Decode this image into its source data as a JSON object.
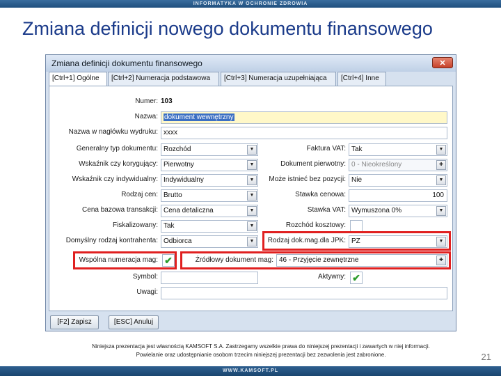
{
  "slide": {
    "header_text": "INFORMATYKA W OCHRONIE ZDROWIA",
    "title": "Zmiana definicji nowego dokumentu finansowego",
    "footer_line1": "Niniejsza prezentacja jest własnością KAMSOFT S.A. Zastrzegamy wszelkie prawa do niniejszej prezentacji i zawartych w niej informacji.",
    "footer_line2": "Powielanie oraz udostępnianie osobom trzecim niniejszej prezentacji bez zezwolenia jest zabronione.",
    "bottom_text": "WWW.KAMSOFT.PL",
    "page_number": "21"
  },
  "window": {
    "title": "Zmiana definicji dokumentu finansowego",
    "close_symbol": "✕",
    "tabs": [
      {
        "label": "[Ctrl+1] Ogólne",
        "active": true
      },
      {
        "label": "[Ctrl+2] Numeracja podstawowa",
        "active": false
      },
      {
        "label": "[Ctrl+3] Numeracja uzupełniająca",
        "active": false
      },
      {
        "label": "[Ctrl+4] Inne",
        "active": false
      }
    ]
  },
  "form": {
    "numer_label": "Numer:",
    "numer_value": "103",
    "nazwa_label": "Nazwa:",
    "nazwa_value": "dokument wewnętrzny",
    "naglowek_label": "Nazwa w nagłówku wydruku:",
    "naglowek_value": "xxxx",
    "generalny_label": "Generalny typ dokumentu:",
    "generalny_value": "Rozchód",
    "korygujacy_label": "Wskaźnik czy korygujący:",
    "korygujacy_value": "Pierwotny",
    "indywidualny_label": "Wskaźnik czy indywidualny:",
    "indywidualny_value": "Indywidualny",
    "rodzaj_cen_label": "Rodzaj cen:",
    "rodzaj_cen_value": "Brutto",
    "cena_bazowa_label": "Cena bazowa transakcji:",
    "cena_bazowa_value": "Cena detaliczna",
    "fiskalizowany_label": "Fiskalizowany:",
    "fiskalizowany_value": "Tak",
    "domyslny_label": "Domyślny rodzaj kontrahenta:",
    "domyslny_value": "Odbiorca",
    "wspolna_label": "Wspólna numeracja mag:",
    "wspolna_checked": "✔",
    "symbol_label": "Symbol:",
    "symbol_value": "",
    "uwagi_label": "Uwagi:",
    "uwagi_value": "",
    "faktura_vat_label": "Faktura VAT:",
    "faktura_vat_value": "Tak",
    "dok_pierwotny_label": "Dokument pierwotny:",
    "dok_pierwotny_value": "0 - Nieokreślony",
    "moze_istniec_label": "Może istnieć bez pozycji:",
    "moze_istniec_value": "Nie",
    "stawka_cenowa_label": "Stawka cenowa:",
    "stawka_cenowa_value": "100",
    "stawka_vat_label": "Stawka VAT:",
    "stawka_vat_value": "Wymuszona 0%",
    "rozchod_kosztowy_label": "Rozchód kosztowy:",
    "rodzaj_jpk_label": "Rodzaj dok.mag.dla JPK:",
    "rodzaj_jpk_value": "PZ",
    "zrodlowy_label": "Źródłowy dokument mag:",
    "zrodlowy_value": "46 - Przyjęcie zewnętrzne",
    "aktywny_label": "Aktywny:",
    "aktywny_checked": "✔"
  },
  "buttons": {
    "save": "[F2] Zapisz",
    "cancel": "[ESC] Anuluj"
  },
  "icons": {
    "dropdown": "▼",
    "plus": "✚"
  },
  "colors": {
    "title": "#1b3b8a",
    "highlight": "#e02020",
    "check": "#2a9c2a"
  }
}
